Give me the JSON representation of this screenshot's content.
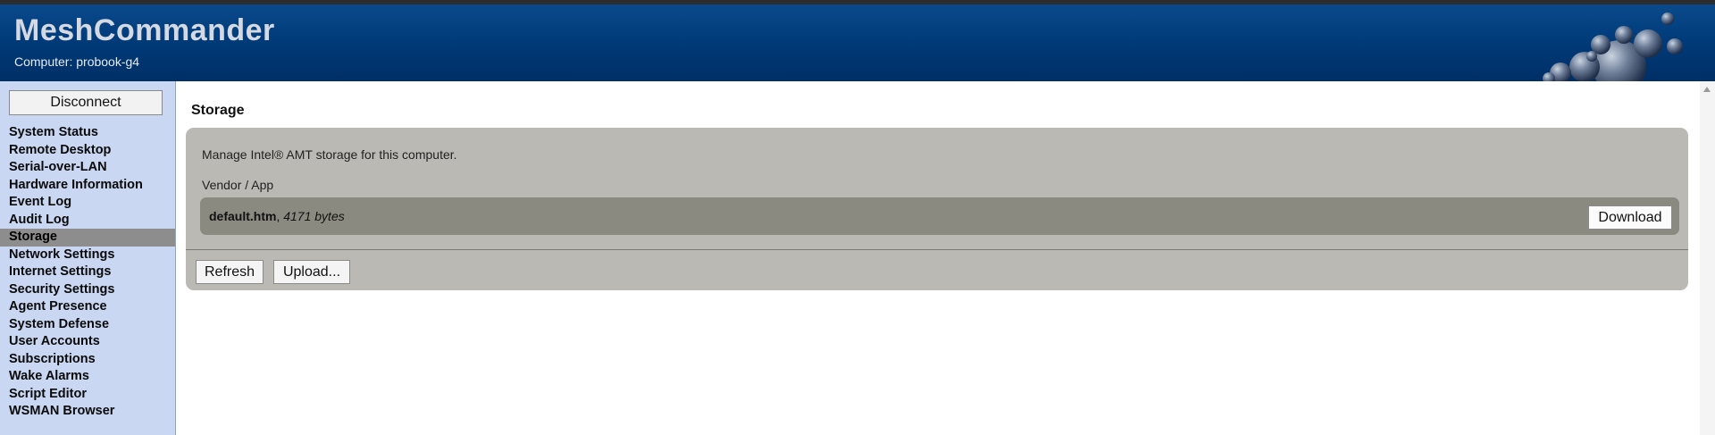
{
  "header": {
    "app_title": "MeshCommander",
    "computer_line": "Computer: probook-g4",
    "logo_icon": "bubbles-logo-icon"
  },
  "sidebar": {
    "disconnect_label": "Disconnect",
    "items": [
      {
        "label": "System Status",
        "active": false
      },
      {
        "label": "Remote Desktop",
        "active": false
      },
      {
        "label": "Serial-over-LAN",
        "active": false
      },
      {
        "label": "Hardware Information",
        "active": false
      },
      {
        "label": "Event Log",
        "active": false
      },
      {
        "label": "Audit Log",
        "active": false
      },
      {
        "label": "Storage",
        "active": true
      },
      {
        "label": "Network Settings",
        "active": false
      },
      {
        "label": "Internet Settings",
        "active": false
      },
      {
        "label": "Security Settings",
        "active": false
      },
      {
        "label": "Agent Presence",
        "active": false
      },
      {
        "label": "System Defense",
        "active": false
      },
      {
        "label": "User Accounts",
        "active": false
      },
      {
        "label": "Subscriptions",
        "active": false
      },
      {
        "label": "Wake Alarms",
        "active": false
      },
      {
        "label": "Script Editor",
        "active": false
      },
      {
        "label": "WSMAN Browser",
        "active": false
      }
    ]
  },
  "main": {
    "page_title": "Storage",
    "description": "Manage Intel® AMT storage for this computer.",
    "group_label": "Vendor / App",
    "file": {
      "name": "default.htm",
      "separator": ", ",
      "size": "4171 bytes",
      "download_label": "Download"
    },
    "refresh_label": "Refresh",
    "upload_label": "Upload..."
  },
  "colors": {
    "header_bg": "#003a78",
    "sidebar_bg": "#c9d7f2",
    "active_item_bg": "#8d8d8d",
    "panel_bg": "#bbb9b3",
    "file_row_bg": "#8a8a80"
  }
}
